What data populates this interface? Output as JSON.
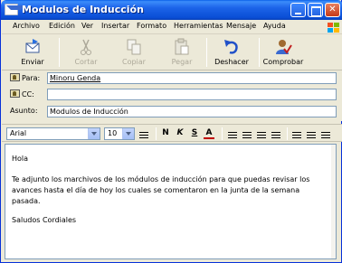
{
  "window": {
    "title": "Modulos de Inducción"
  },
  "menu": [
    "Archivo",
    "Edición",
    "Ver",
    "Insertar",
    "Formato",
    "Herramientas",
    "Mensaje",
    "Ayuda"
  ],
  "toolbar": {
    "send": "Enviar",
    "cut": "Cortar",
    "copy": "Copiar",
    "paste": "Pegar",
    "undo": "Deshacer",
    "check": "Comprobar"
  },
  "header": {
    "to_label": "Para:",
    "to_value": "Minoru Genda",
    "cc_label": "CC:",
    "cc_value": "",
    "subject_label": "Asunto:",
    "subject_value": "Modulos de Inducción"
  },
  "format": {
    "font": "Arial",
    "size": "10"
  },
  "message": {
    "greeting": "Hola",
    "line1": "Te adjunto los marchivos de los módulos de inducción para que puedas revisar los",
    "line2": "avances hasta el día de hoy los cuales se comentaron en la junta de la semana",
    "line3": "pasada.",
    "closing": "Saludos Cordiales"
  },
  "colors": {
    "titlebar": "#0a4fd6",
    "close": "#c63a18",
    "window_bg": "#ece9d8"
  }
}
